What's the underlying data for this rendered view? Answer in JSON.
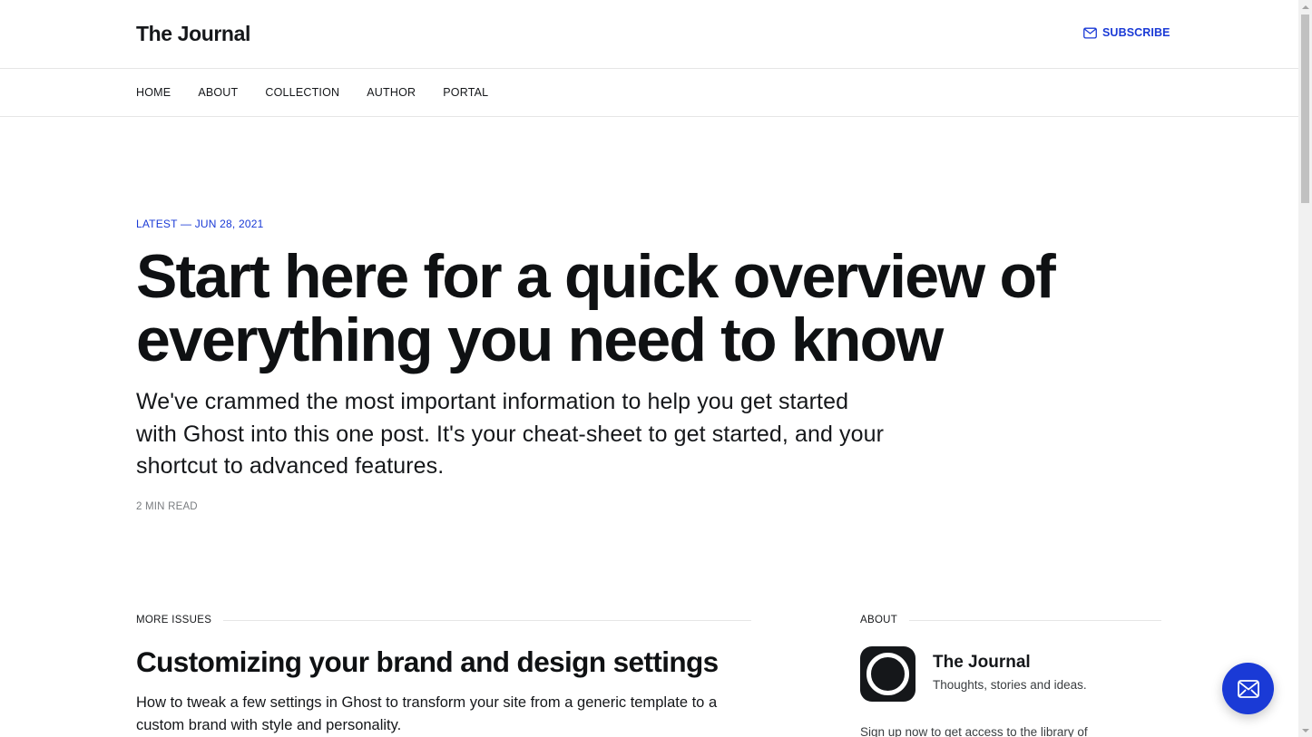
{
  "site": {
    "title": "The Journal",
    "subscribe_label": "SUBSCRIBE",
    "accent_color": "#1a3ad6"
  },
  "nav": {
    "items": [
      "HOME",
      "ABOUT",
      "COLLECTION",
      "AUTHOR",
      "PORTAL"
    ]
  },
  "hero": {
    "kicker": "LATEST — JUN 28, 2021",
    "title": "Start here for a quick overview of everything you need to know",
    "excerpt": "We've crammed the most important information to help you get started with Ghost into this one post. It's your cheat-sheet to get started, and your shortcut to advanced features.",
    "read_time": "2 MIN READ"
  },
  "more_issues": {
    "label": "MORE ISSUES",
    "posts": [
      {
        "title": "Customizing your brand and design settings",
        "excerpt": "How to tweak a few settings in Ghost to transform your site from a generic template to a custom brand with style and personality."
      }
    ]
  },
  "about": {
    "label": "ABOUT",
    "name": "The Journal",
    "description": "Thoughts, stories and ideas.",
    "signup_text": "Sign up now to get access to the library of"
  },
  "icons": {
    "subscribe": "envelope-icon",
    "fab": "envelope-icon"
  }
}
